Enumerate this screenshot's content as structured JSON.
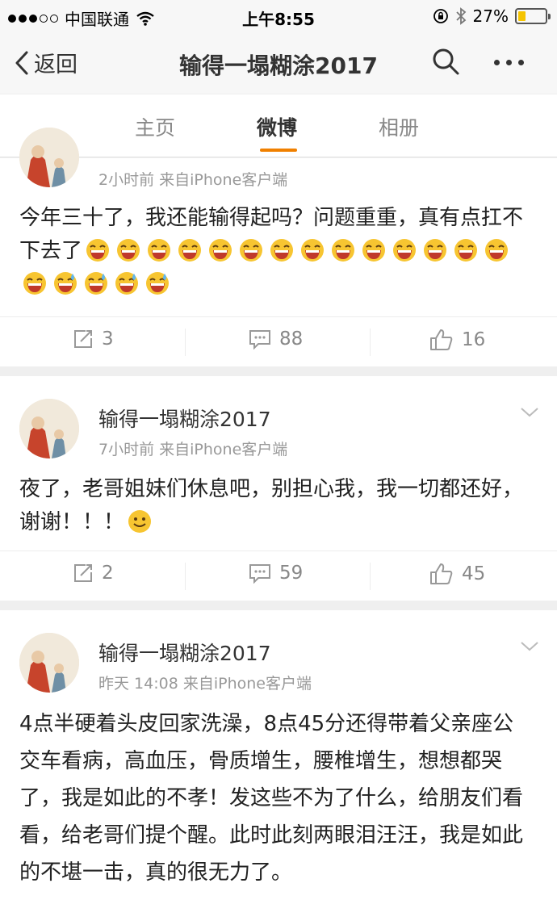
{
  "status_bar": {
    "carrier": "中国联通",
    "time": "上午8:55",
    "battery": "27%",
    "battery_level": 0.27
  },
  "nav": {
    "back_label": "返回",
    "title": "输得一塌糊涂2017"
  },
  "tabs": [
    {
      "label": "主页"
    },
    {
      "label": "微博",
      "active": true
    },
    {
      "label": "相册"
    }
  ],
  "posts": [
    {
      "meta": "2小时前  来自iPhone客户端",
      "text": "今年三十了，我还能输得起吗？问题重重，真有点扛不下去了",
      "emojis": [
        "grin-emoji",
        "grin-emoji",
        "grin-emoji",
        "grin-emoji",
        "grin-emoji",
        "grin-emoji",
        "grin-emoji",
        "grin-emoji",
        "grin-emoji",
        "grin-emoji",
        "grin-emoji",
        "grin-emoji",
        "grin-emoji",
        "grin-emoji",
        "grin-emoji",
        "sweat-smile-emoji",
        "sweat-smile-emoji",
        "sweat-smile-emoji",
        "sweat-smile-emoji"
      ],
      "reposts": "3",
      "comments": "88",
      "likes": "16"
    },
    {
      "author": "输得一塌糊涂2017",
      "meta": "7小时前  来自iPhone客户端",
      "text": "夜了，老哥姐妹们休息吧，别担心我，我一切都还好，谢谢！！！",
      "emojis": [
        "smile-emoji"
      ],
      "reposts": "2",
      "comments": "59",
      "likes": "45"
    },
    {
      "author": "输得一塌糊涂2017",
      "meta": "昨天 14:08  来自iPhone客户端",
      "text": "4点半硬着头皮回家洗澡，8点45分还得带着父亲座公交车看病，高血压，骨质增生，腰椎增生，想想都哭了，我是如此的不孝！发这些不为了什么，给朋友们看看，给老哥们提个醒。此时此刻两眼泪汪汪，我是如此的不堪一击，真的很无力了。"
    }
  ],
  "colors": {
    "accent": "#f08000",
    "emoji_yellow": "#f7c531",
    "background": "#efefef"
  }
}
